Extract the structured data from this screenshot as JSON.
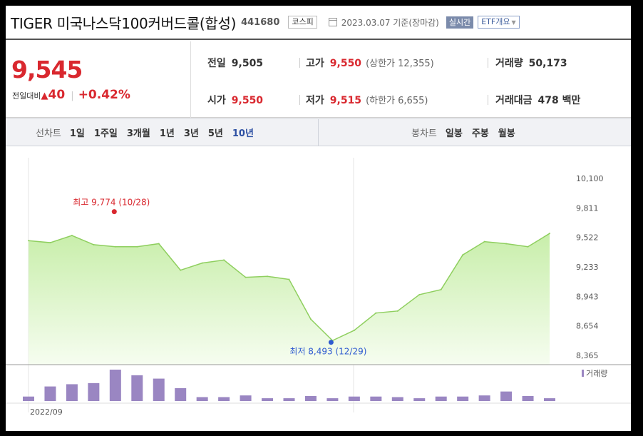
{
  "header": {
    "stock_name": "TIGER 미국나스닥100커버드콜(합성)",
    "stock_code": "441680",
    "market_badge": "코스피",
    "date_text": "2023.03.07 기준(장마감)",
    "realtime_badge": "실시간",
    "etf_overview_button": "ETF개요",
    "calendar_icon": "calendar-icon",
    "dropdown_icon": "chevron-down-icon"
  },
  "summary": {
    "current_price": "9,545",
    "change_label": "전일대비",
    "change_direction_icon": "up-triangle-icon",
    "change_symbol": "▲",
    "change_value": "40",
    "change_percent": "+0.42%",
    "separator": "|",
    "prev_close": {
      "label": "전일",
      "value": "9,505"
    },
    "high": {
      "label": "고가",
      "value": "9,550",
      "limit_label": "(상한가 12,355)"
    },
    "volume": {
      "label": "거래량",
      "value": "50,173"
    },
    "open": {
      "label": "시가",
      "value": "9,550"
    },
    "low": {
      "label": "저가",
      "value": "9,515",
      "limit_label": "(하한가 6,655)"
    },
    "trade_amount": {
      "label": "거래대금",
      "value": "478 백만"
    }
  },
  "tabs": {
    "line_chart_title": "선차트",
    "line_periods": [
      "1일",
      "1주일",
      "3개월",
      "1년",
      "3년",
      "5년",
      "10년"
    ],
    "active_period": "10년",
    "candle_chart_title": "봉차트",
    "candle_periods": [
      "일봉",
      "주봉",
      "월봉"
    ]
  },
  "colors": {
    "up_red": "#d9282f",
    "line_green": "#8fcf5f",
    "area_green": "#dff5cd",
    "volume_purple": "#9a86c2",
    "active_tab_blue": "#2c4fa2",
    "low_marker_blue": "#2e5bd0"
  },
  "chart_data": {
    "type": "area",
    "ylim": [
      8365,
      10100
    ],
    "yticks": [
      "10,100",
      "9,811",
      "9,522",
      "9,233",
      "8,943",
      "8,654",
      "8,365"
    ],
    "ytick_values": [
      10100,
      9811,
      9522,
      9233,
      8943,
      8654,
      8365
    ],
    "xtick_labels": [
      "2022/09"
    ],
    "series": [
      {
        "values": [
          9490,
          9470,
          9540,
          9450,
          9430,
          9430,
          9460,
          9200,
          9270,
          9300,
          9130,
          9140,
          9110,
          8720,
          8510,
          8610,
          8780,
          8800,
          8960,
          9010,
          9350,
          9480,
          9460,
          9430,
          9560
        ]
      }
    ],
    "max_annotation": {
      "label": "최고",
      "value": "9,774",
      "date": "(10/28)",
      "numeric": 9774,
      "index": 5
    },
    "min_annotation": {
      "label": "최저",
      "value": "8,493",
      "date": "(12/29)",
      "numeric": 8493,
      "index": 14
    },
    "volume": {
      "legend": "거래량",
      "values": [
        8,
        26,
        30,
        32,
        56,
        46,
        40,
        23,
        7,
        7,
        10,
        5,
        5,
        9,
        5,
        8,
        8,
        7,
        5,
        8,
        8,
        10,
        17,
        9,
        5
      ]
    }
  }
}
